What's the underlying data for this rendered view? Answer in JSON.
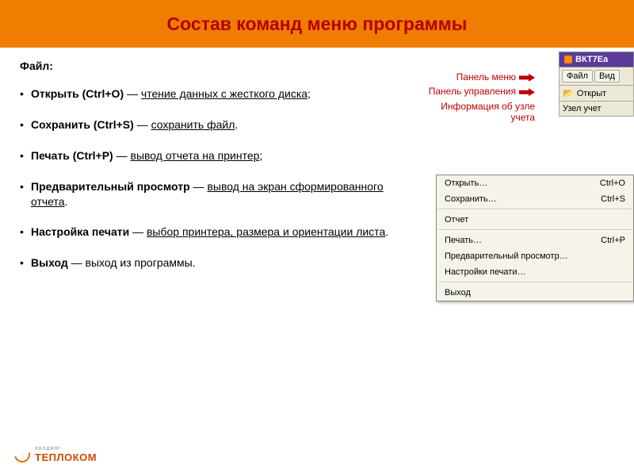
{
  "header": {
    "title": "Состав команд меню программы"
  },
  "section": {
    "title": "Файл:"
  },
  "items": [
    {
      "bold": "Открыть (Ctrl+O)",
      "dash": " — ",
      "rest": "чтение данных с жесткого диска",
      "suffix": ";"
    },
    {
      "bold": "Сохранить (Ctrl+S)",
      "dash": " — ",
      "rest": "сохранить файл",
      "suffix": "."
    },
    {
      "bold": "Печать (Ctrl+P)",
      "dash": " — ",
      "rest": "вывод отчета на принтер",
      "suffix": ";"
    },
    {
      "bold": "Предварительный просмотр",
      "dash": " — ",
      "rest": "вывод на экран сформированного отчета",
      "suffix": "."
    },
    {
      "bold": "Настройка печати",
      "dash": " — ",
      "rest": "выбор принтера, размера и ориентации листа",
      "suffix": "."
    },
    {
      "bold": "Выход",
      "dash": " — ",
      "rest_plain": "выход из программы."
    }
  ],
  "callouts": {
    "menu_panel": "Панель меню",
    "control_panel": "Панель управления",
    "node_info": "Информация об узле учета"
  },
  "app": {
    "title": "ВКТ7Еa",
    "tab_file": "Файл",
    "tab_view": "Вид",
    "toolbar_open": "Открыт",
    "toolbar_node": "Узел учет"
  },
  "menu": {
    "open": {
      "label": "Открыть…",
      "shortcut": "Ctrl+O"
    },
    "save": {
      "label": "Сохранить…",
      "shortcut": "Ctrl+S"
    },
    "report": {
      "label": "Отчет",
      "shortcut": ""
    },
    "print": {
      "label": "Печать…",
      "shortcut": "Ctrl+P"
    },
    "preview": {
      "label": "Предварительный просмотр…",
      "shortcut": ""
    },
    "setup": {
      "label": "Настройки печати…",
      "shortcut": ""
    },
    "exit": {
      "label": "Выход",
      "shortcut": ""
    }
  },
  "footer": {
    "brand": "ТЕПЛОКОМ",
    "sub": "холдинг"
  }
}
